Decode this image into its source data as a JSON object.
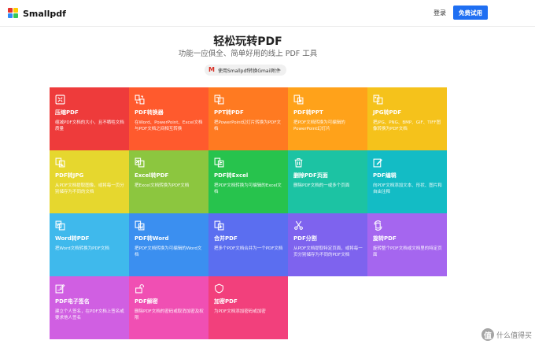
{
  "header": {
    "logo_text": "Smallpdf",
    "login_label": "登录",
    "trial_label": "免费试用"
  },
  "hero": {
    "title": "轻松玩转PDF",
    "subtitle": "功能一应俱全、简单好用的线上 PDF 工具",
    "gmail_label": "使用Smallpdf转换Gmail附件"
  },
  "tools": [
    {
      "title": "压缩PDF",
      "desc": "缩减PDF文档的大小，且不牺牲文档质量",
      "color": "#ee3b3b",
      "icon": "compress-icon"
    },
    {
      "title": "PDF转换器",
      "desc": "在Word、PowerPoint、Excel文档与PDF文档之间相互转换",
      "color": "#ff5a2d",
      "icon": "convert-icon"
    },
    {
      "title": "PPT转PDF",
      "desc": "把PowerPoint幻灯片转换为PDF文档",
      "color": "#ff7a21",
      "icon": "ppt-to-pdf-icon"
    },
    {
      "title": "PDF转PPT",
      "desc": "把PDF文档转换为可编辑的PowerPoint幻灯片",
      "color": "#ffa21a",
      "icon": "pdf-to-ppt-icon"
    },
    {
      "title": "JPG转PDF",
      "desc": "把JPG、PNG、BMP、GIF、TIFF图像转换为PDF文档",
      "color": "#f5c21b",
      "icon": "jpg-to-pdf-icon"
    },
    {
      "title": "PDF转JPG",
      "desc": "从PDF文档提取图像，或将每一页分别储存为不同的文档",
      "color": "#e6d72e",
      "icon": "pdf-to-jpg-icon"
    },
    {
      "title": "Excel转PDF",
      "desc": "把Excel文档转换为PDF文档",
      "color": "#8cc63f",
      "icon": "excel-to-pdf-icon"
    },
    {
      "title": "PDF转Excel",
      "desc": "把PDF文档转换为可编辑的Excel文档",
      "color": "#27c34d",
      "icon": "pdf-to-excel-icon"
    },
    {
      "title": "删除PDF页面",
      "desc": "删除PDF文档的一或多个页面",
      "color": "#1cc3a3",
      "icon": "trash-icon"
    },
    {
      "title": "PDF编辑",
      "desc": "向PDF文档添加文本、形状、图片和自由注释",
      "color": "#13bcc5",
      "icon": "edit-icon"
    },
    {
      "title": "Word转PDF",
      "desc": "把Word文档转换为PDF文档",
      "color": "#3fb9ec",
      "icon": "word-to-pdf-icon"
    },
    {
      "title": "PDF转Word",
      "desc": "把PDF文档转换为可编辑的Word文档",
      "color": "#3b8ff0",
      "icon": "pdf-to-word-icon"
    },
    {
      "title": "合并PDF",
      "desc": "把多个PDF文档合并为一个PDF文档",
      "color": "#5b6ef0",
      "icon": "merge-icon"
    },
    {
      "title": "PDF分割",
      "desc": "从PDF文档提取特定页面，或将每一页分别储存为不同的PDF文档",
      "color": "#7e63ee",
      "icon": "scissors-icon"
    },
    {
      "title": "旋转PDF",
      "desc": "旋转整个PDF文档或文档里的特定页面",
      "color": "#a566ef",
      "icon": "rotate-icon"
    },
    {
      "title": "PDF电子签名",
      "desc": "建立个人签名，在PDF文档上签名或要求他人签名",
      "color": "#d05fe2",
      "icon": "sign-icon"
    },
    {
      "title": "PDF解密",
      "desc": "删除PDF文档的密码或取消加密及权限",
      "color": "#f04fb3",
      "icon": "unlock-icon"
    },
    {
      "title": "加密PDF",
      "desc": "为PDF文档添加密码或加密",
      "color": "#f2407c",
      "icon": "shield-icon"
    }
  ],
  "watermark": {
    "badge": "值",
    "text": "什么值得买"
  }
}
